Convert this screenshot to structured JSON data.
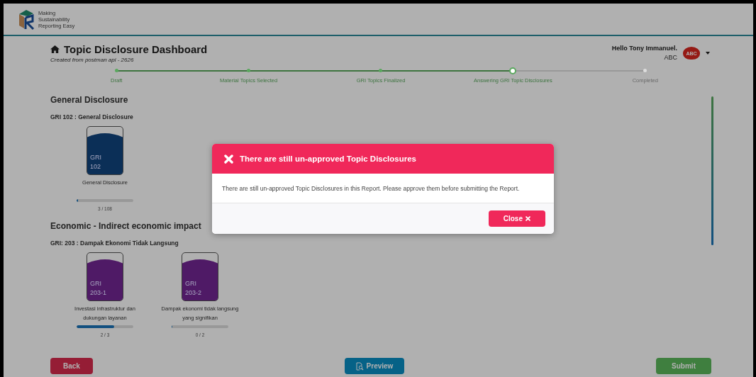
{
  "header": {
    "logo_tagline": "Making Sustainability Reporting Easy"
  },
  "page": {
    "title": "Topic Disclosure Dashboard",
    "subtitle": "Created from postman api - 2626"
  },
  "user": {
    "greeting": "Hello Tony Immanuel.",
    "company": "ABC",
    "avatar_text": "ABC"
  },
  "stepper": [
    {
      "label": "Draft",
      "completed": true,
      "current": false
    },
    {
      "label": "Material Topics Selected",
      "completed": true,
      "current": false
    },
    {
      "label": "GRI Topics Finalized",
      "completed": true,
      "current": false
    },
    {
      "label": "Answering GRI Topic Disclosures",
      "completed": false,
      "current": true
    },
    {
      "label": "Completed",
      "completed": false,
      "current": false
    }
  ],
  "sections": [
    {
      "title": "General Disclosure",
      "group": "GRI 102 : General Disclosure",
      "topics": [
        {
          "code_prefix": "GRI",
          "code": "102",
          "name": "General Disclosure",
          "color": "#0b2f57",
          "level": 0.028,
          "count": "3 / 108"
        }
      ]
    },
    {
      "title": "Economic - Indirect economic impact",
      "group": "GRI: 203 : Dampak Ekonomi Tidak Langsung",
      "topics": [
        {
          "code_prefix": "GRI",
          "code": "203-1",
          "name": "Investasi infrastruktur dan dukungan layanan",
          "color": "#4f1a66",
          "level": 0.667,
          "count": "2 / 3"
        },
        {
          "code_prefix": "GRI",
          "code": "203-2",
          "name": "Dampak ekonomi tidak langsung yang signifikan",
          "color": "#4f1a66",
          "level": 0,
          "count": "0 / 2"
        }
      ]
    }
  ],
  "buttons": {
    "back": "Back",
    "preview": "Preview",
    "submit": "Submit"
  },
  "modal": {
    "title": "There are still un-approved Topic Disclosures",
    "message": "There are still un-approved Topic Disclosures in this Report. Please approve them before submitting the Report.",
    "close_label": "Close"
  }
}
